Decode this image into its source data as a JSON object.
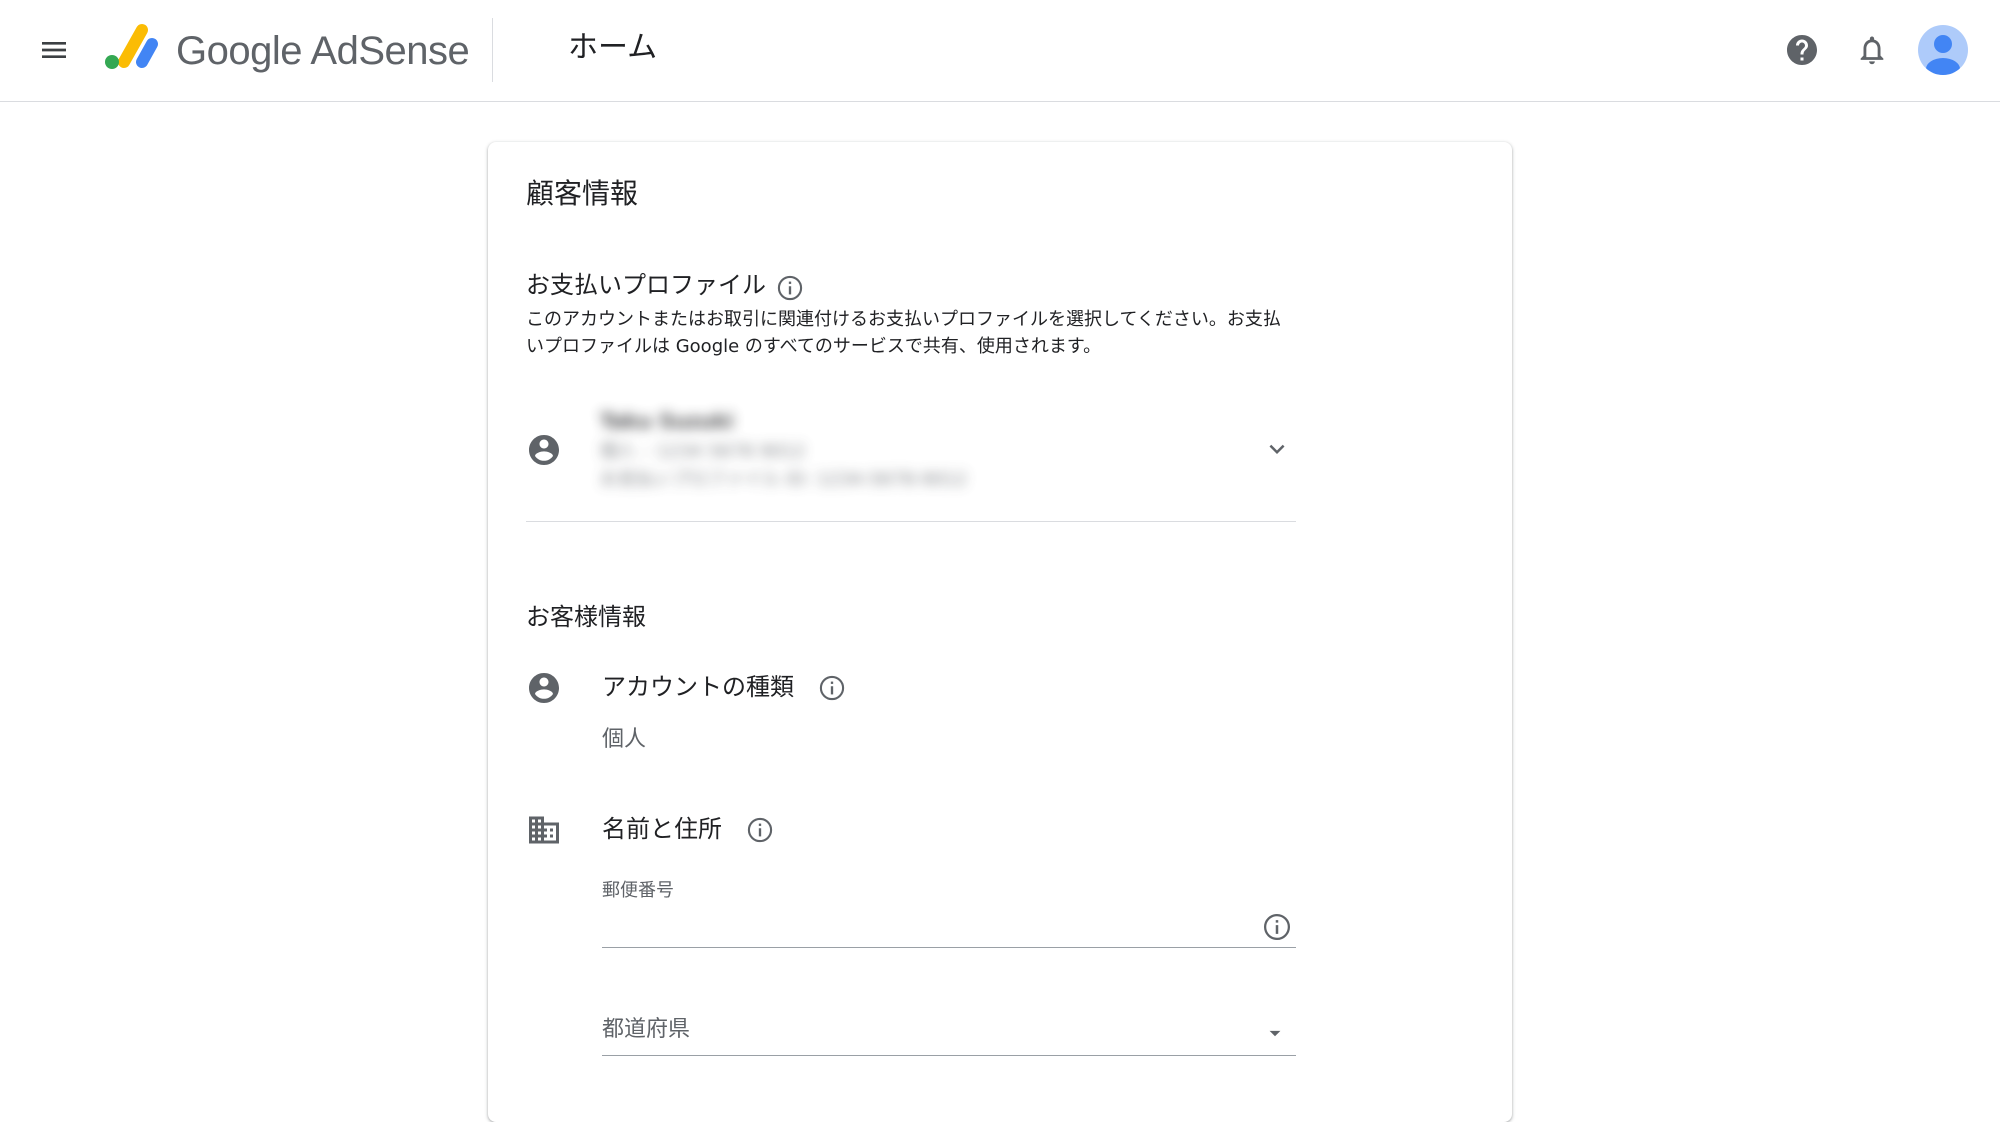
{
  "header": {
    "logo_text": "Google AdSense",
    "page_title": "ホーム",
    "logo_colors": [
      "#fbbc04",
      "#34a853",
      "#4285f4"
    ],
    "icons": [
      "menu-icon",
      "help-icon",
      "bell-icon",
      "avatar"
    ]
  },
  "card": {
    "title": "顧客情報",
    "payment_profile": {
      "title": "お支払いプロファイル",
      "description": "このアカウントまたはお取引に関連付けるお支払いプロファイルを選択してください。お支払いプロファイルは Google のすべてのサービスで共有、使用されます。",
      "selected_profile": {
        "line1": "Taku Suzuki",
        "line2": "個人 – 1234 5678 9012",
        "line3": "お支払いプロファイル ID: 1234-5678-9012"
      }
    },
    "customer_info": {
      "title": "お客様情報",
      "account_type": {
        "label": "アカウントの種類",
        "value": "個人"
      },
      "name_address": {
        "label": "名前と住所",
        "postal_code": {
          "label": "郵便番号",
          "value": ""
        },
        "prefecture": {
          "label": "都道府県"
        }
      }
    }
  },
  "colors": {
    "icon_gray": "#5f6368",
    "divider": "#dadce0",
    "avatar_bg": "#aecbfa",
    "avatar_fg": "#4285f4"
  }
}
